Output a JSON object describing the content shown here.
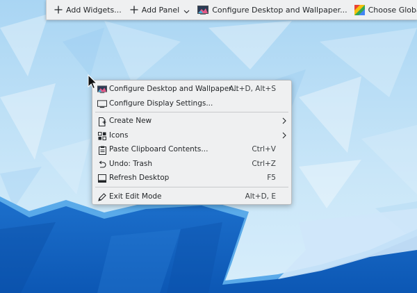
{
  "toolbar": {
    "add_widgets": "Add Widgets...",
    "add_panel": "Add Panel",
    "configure_desktop": "Configure Desktop and Wallpaper...",
    "choose_global_theme": "Choose Global Theme..."
  },
  "menu": {
    "items": [
      {
        "label": "Configure Desktop and Wallpaper...",
        "shortcut": "Alt+D, Alt+S",
        "icon": "wallpaper-icon"
      },
      {
        "label": "Configure Display Settings...",
        "shortcut": "",
        "icon": "monitor-icon"
      },
      {
        "label": "Create New",
        "shortcut": "",
        "icon": "new-document-icon",
        "submenu": true
      },
      {
        "label": "Icons",
        "shortcut": "",
        "icon": "icons-grid-icon",
        "submenu": true
      },
      {
        "label": "Paste Clipboard Contents...",
        "shortcut": "Ctrl+V",
        "icon": "clipboard-icon"
      },
      {
        "label": "Undo: Trash",
        "shortcut": "Ctrl+Z",
        "icon": "undo-icon"
      },
      {
        "label": "Refresh Desktop",
        "shortcut": "F5",
        "icon": "refresh-desktop-icon"
      },
      {
        "label": "Exit Edit Mode",
        "shortcut": "Alt+D, E",
        "icon": "pencil-icon"
      }
    ]
  },
  "colors": {
    "sky_light": "#d7ecfb",
    "sky_mid": "#bfe0f7",
    "deep_blue": "#1465c0",
    "mid_blue": "#3d8ddc",
    "menu_bg": "#eff0f1",
    "text": "#232629"
  }
}
